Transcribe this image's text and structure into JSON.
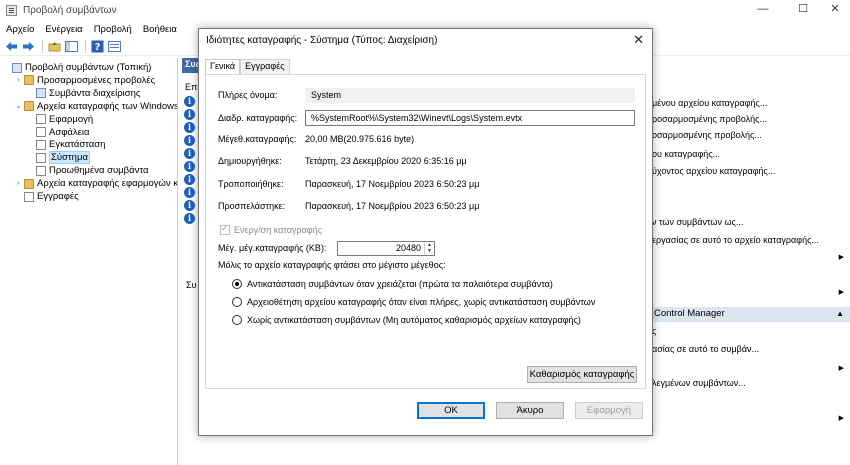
{
  "window": {
    "title": "Προβολή συμβάντων",
    "minimize": "—",
    "maximize": "☐",
    "close": "✕"
  },
  "menu": [
    "Αρχείο",
    "Ενέργεια",
    "Προβολή",
    "Βοήθεια"
  ],
  "toolbar": {
    "icons": [
      "back-arrow-icon",
      "forward-arrow-icon",
      "folder-up-icon",
      "show-hide-tree-icon",
      "help-icon",
      "properties-icon"
    ]
  },
  "tree": {
    "items": [
      {
        "label": "Προβολή συμβάντων (Τοπική)",
        "level": 0,
        "expander": "",
        "icon": "view"
      },
      {
        "label": "Προσαρμοσμένες προβολές",
        "level": 1,
        "expander": "›",
        "icon": "folder"
      },
      {
        "label": "Συμβάντα διαχείρισης",
        "level": 2,
        "expander": "",
        "icon": "view"
      },
      {
        "label": "Αρχεία καταγραφής των Windows",
        "level": 1,
        "expander": "⌄",
        "icon": "folder"
      },
      {
        "label": "Εφαρμογή",
        "level": 2,
        "expander": "",
        "icon": "log"
      },
      {
        "label": "Ασφάλεια",
        "level": 2,
        "expander": "",
        "icon": "log"
      },
      {
        "label": "Εγκατάσταση",
        "level": 2,
        "expander": "",
        "icon": "log"
      },
      {
        "label": "Σύστημα",
        "level": 2,
        "expander": "",
        "icon": "log",
        "selected": true
      },
      {
        "label": "Προωθημένα συμβάντα",
        "level": 2,
        "expander": "",
        "icon": "log"
      },
      {
        "label": "Αρχεία καταγραφής εφαρμογών και υ",
        "level": 1,
        "expander": "›",
        "icon": "folder"
      },
      {
        "label": "Εγγραφές",
        "level": 1,
        "expander": "",
        "icon": "log"
      }
    ]
  },
  "middle": {
    "header": "Συς",
    "col_label": "Επι",
    "bottom_label": "Συ"
  },
  "actions": {
    "items": [
      "μένου αρχείου καταγραφής...",
      "ροσαρμοσμένης προβολής...",
      "οσαρμοσμένης προβολής...",
      "ου καταγραφής...",
      "ύχοντος αρχείου καταγραφής...",
      "ν των συμβάντων ως...",
      "εργασίας σε αυτό το αρχείο καταγραφής...",
      "ς",
      "ασίας σε αυτό το συμβάν...",
      "λεγμένων συμβάντων..."
    ],
    "section2_header": "Control Manager"
  },
  "dialog": {
    "title": "Ιδιότητες καταγραφής - Σύστημα (Τύπος: Διαχείριση)",
    "close": "✕",
    "tabs": [
      "Γενικά",
      "Εγγραφές"
    ],
    "fields": {
      "full_name_label": "Πλήρες όνομα:",
      "full_name_value": "System",
      "log_path_label": "Διαδρ. καταγραφής:",
      "log_path_value": "%SystemRoot%\\System32\\Winevt\\Logs\\System.evtx",
      "log_size_label": "Μέγεθ.καταγραφής:",
      "log_size_value": "20,00 MB(20.975.616 byte)",
      "created_label": "Δημιουργήθηκε:",
      "created_value": "Τετάρτη, 23 Δεκεμβρίου 2020 6:35:16 μμ",
      "modified_label": "Τροποποιήθηκε:",
      "modified_value": "Παρασκευή, 17 Νοεμβρίου 2023 6:50:23 μμ",
      "accessed_label": "Προσπελάστηκε:",
      "accessed_value": "Παρασκευή, 17 Νοεμβρίου 2023 6:50:23 μμ"
    },
    "enable_logging_label": "Ενεργ/ση καταγραφής",
    "max_size_label": "Μέγ. μέγ.καταγραφής (KB):",
    "max_size_value": "20480",
    "when_max_label": "Μόλις το αρχείο καταγραφής φτάσει στο μέγιστο μέγεθος:",
    "radios": [
      {
        "label": "Αντικατάσταση συμβάντων όταν χρειάζεται (πρώτα τα παλαιότερα συμβάντα)",
        "checked": true
      },
      {
        "label": "Αρχειοθέτηση αρχείου καταγραφής όταν είναι πλήρες, χωρίς αντικατάσταση συμβάντων",
        "checked": false
      },
      {
        "label": "Χωρίς αντικατάσταση συμβάντων (Μη αυτόματος καθαρισμός αρχείων καταγραφής)",
        "checked": false
      }
    ],
    "clear_log_button": "Καθαρισμός καταγραφής",
    "ok_button": "OK",
    "cancel_button": "Άκυρο",
    "apply_button": "Εφαρμογή"
  }
}
